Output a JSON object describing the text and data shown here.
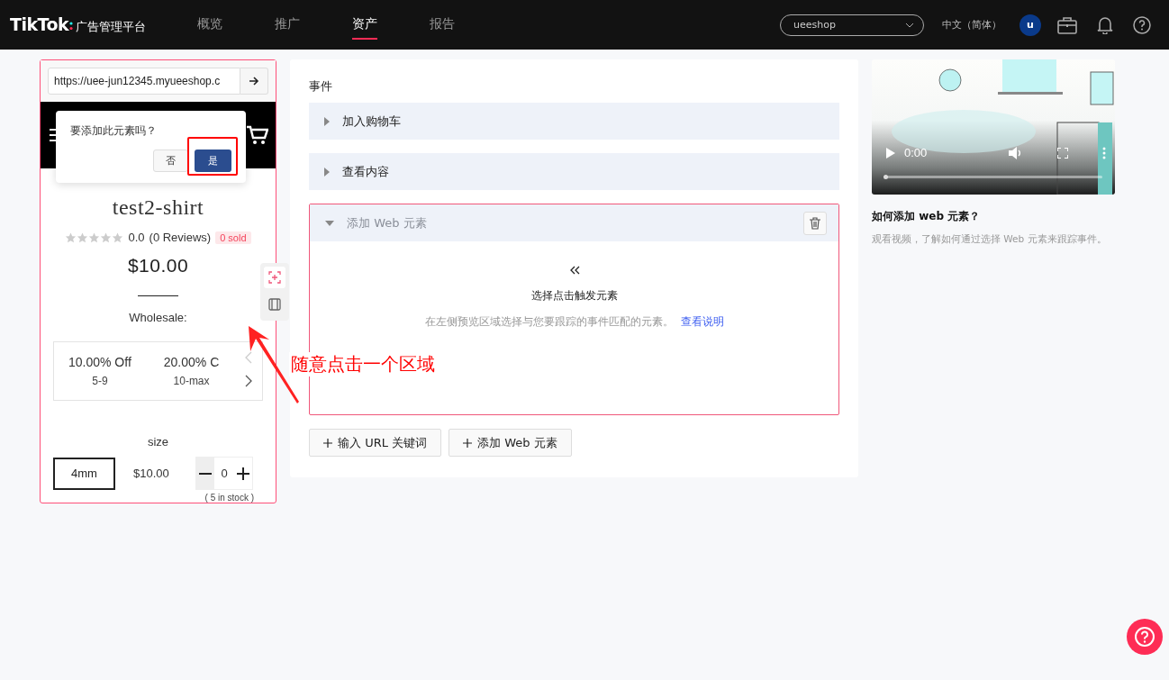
{
  "topbar": {
    "logo": "TikTok",
    "logo_suffix": "广告管理平台",
    "nav": [
      {
        "label": "概览",
        "selected": false
      },
      {
        "label": "推广",
        "selected": false
      },
      {
        "label": "资产",
        "selected": true
      },
      {
        "label": "报告",
        "selected": false
      }
    ],
    "account": "ueeshop",
    "language": "中文（简体）",
    "avatar": "u"
  },
  "preview": {
    "url": "https://uee-jun12345.myueeshop.c",
    "popup": {
      "question": "要添加此元素吗？",
      "buttons": [
        "否",
        "是"
      ]
    },
    "product": {
      "title": "test2-shirt",
      "stars": 0,
      "rating": "0.0",
      "reviews": "(0 Reviews)",
      "sold": "0 sold",
      "price": "$10.00",
      "wholesale_label": "Wholesale:",
      "tiers": [
        {
          "discount": "10.00% Off",
          "range": "5-9"
        },
        {
          "discount": "20.00% C",
          "range": "10-max"
        }
      ],
      "size_label": "size",
      "variant": {
        "size": "4mm",
        "price": "$10.00",
        "quantity": "0",
        "stock": "( 5 in stock )"
      }
    }
  },
  "events": {
    "title": "事件",
    "items": [
      {
        "label": "加入购物车",
        "expanded": false
      },
      {
        "label": "查看内容",
        "expanded": false
      },
      {
        "label": "添加 Web 元素",
        "expanded": true,
        "content": {
          "heading": "选择点击触发元素",
          "hint": "在左侧预览区域选择与您要跟踪的事件匹配的元素。",
          "link": "查看说明"
        }
      }
    ],
    "buttons": [
      "输入 URL 关键词",
      "添加 Web 元素"
    ]
  },
  "help": {
    "video_time": "0:00",
    "video_progress": {
      "level": 0
    },
    "title": "如何添加 web 元素？",
    "description": "观看视频，了解如何通过选择 Web 元素来跟踪事件。"
  },
  "annotation": {
    "text": "随意点击一个区域"
  }
}
